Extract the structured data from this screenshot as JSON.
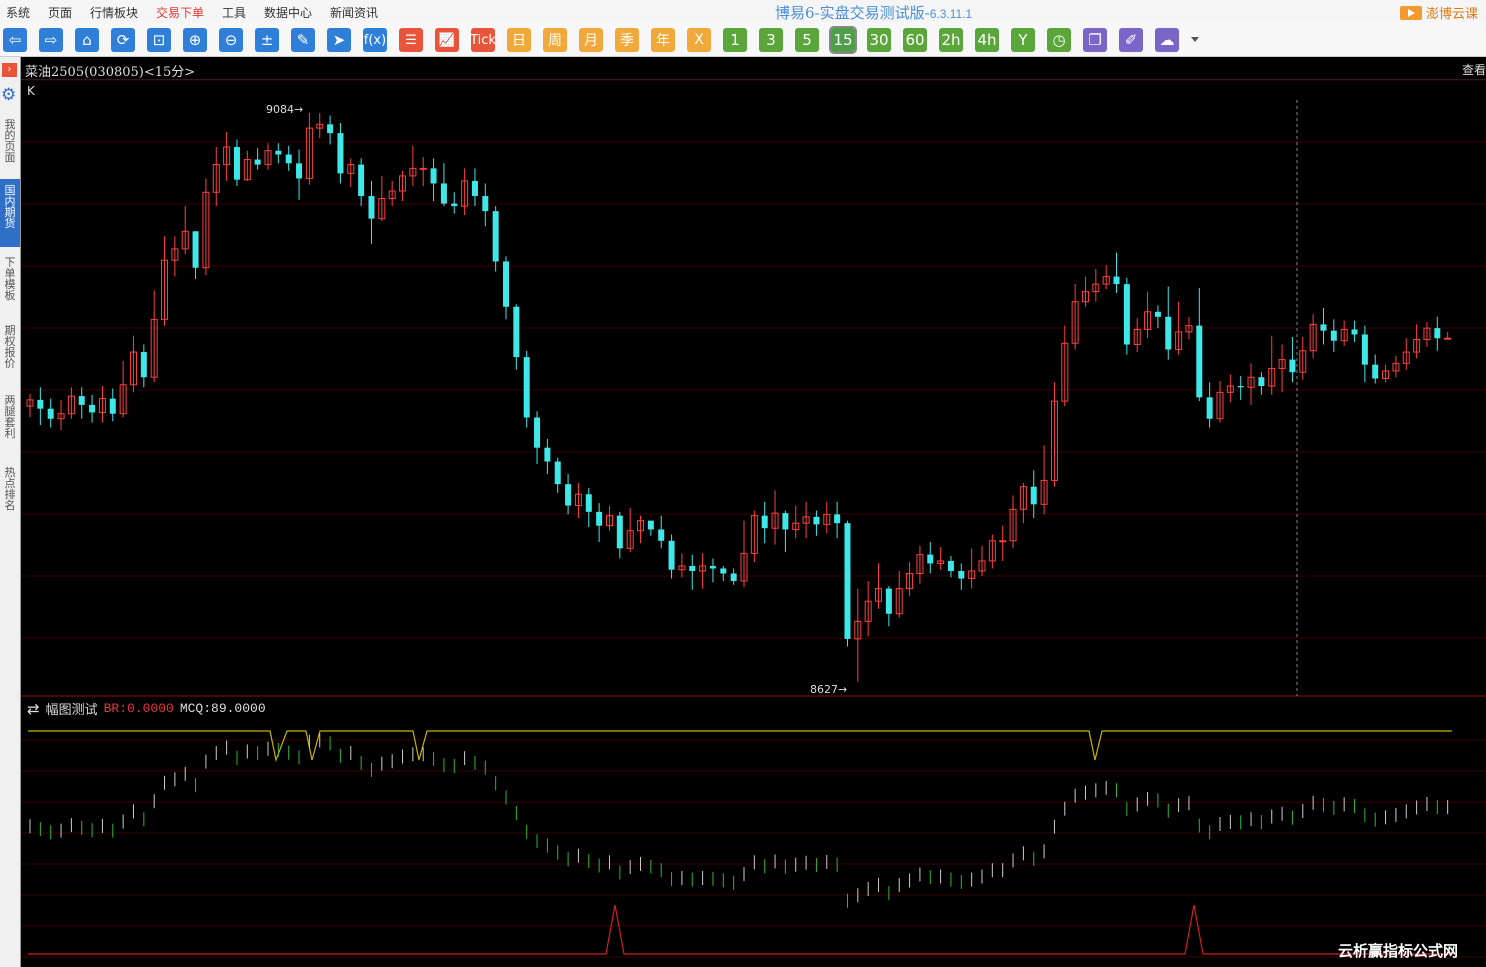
{
  "menu": [
    "系统",
    "页面",
    "行情板块",
    "交易下单",
    "工具",
    "数据中心",
    "新闻资讯"
  ],
  "menu_active_index": 3,
  "app": {
    "title": "博易6-实盘交易测试版-",
    "version": "6.3.11.1",
    "brand": "澎博云课"
  },
  "toolbar": {
    "buttons": [
      {
        "name": "back-arrow-icon",
        "glyph": "⇦",
        "color": "blue"
      },
      {
        "name": "forward-arrow-icon",
        "glyph": "⇨",
        "color": "blue"
      },
      {
        "name": "home-icon",
        "glyph": "⌂",
        "color": "blue"
      },
      {
        "name": "refresh-icon",
        "glyph": "⟳",
        "color": "blue"
      },
      {
        "name": "crop-icon",
        "glyph": "⊡",
        "color": "blue"
      },
      {
        "name": "zoom-in-icon",
        "glyph": "⊕",
        "color": "blue"
      },
      {
        "name": "zoom-out-icon",
        "glyph": "⊖",
        "color": "blue"
      },
      {
        "name": "calculator-icon",
        "glyph": "±",
        "color": "blue"
      },
      {
        "name": "pencil-icon",
        "glyph": "✎",
        "color": "blue"
      },
      {
        "name": "cursor-icon",
        "glyph": "➤",
        "color": "blue"
      },
      {
        "name": "formula-icon",
        "glyph": "f(x)",
        "color": "blue"
      },
      {
        "name": "list-icon",
        "glyph": "☰",
        "color": "red"
      },
      {
        "name": "chart-line-icon",
        "glyph": "📈",
        "color": "red"
      },
      {
        "name": "tick-button",
        "glyph": "Tick",
        "color": "red"
      },
      {
        "name": "period-day-button",
        "glyph": "日",
        "color": "orange"
      },
      {
        "name": "period-week-button",
        "glyph": "周",
        "color": "orange"
      },
      {
        "name": "period-month-button",
        "glyph": "月",
        "color": "orange"
      },
      {
        "name": "period-season-button",
        "glyph": "季",
        "color": "orange"
      },
      {
        "name": "period-year-button",
        "glyph": "年",
        "color": "orange"
      },
      {
        "name": "period-x-button",
        "glyph": "X",
        "color": "orange"
      },
      {
        "name": "period-1-button",
        "glyph": "1",
        "color": "green"
      },
      {
        "name": "period-3-button",
        "glyph": "3",
        "color": "green"
      },
      {
        "name": "period-5-button",
        "glyph": "5",
        "color": "green"
      },
      {
        "name": "period-15-button",
        "glyph": "15",
        "color": "green"
      },
      {
        "name": "period-30-button",
        "glyph": "30",
        "color": "green"
      },
      {
        "name": "period-60-button",
        "glyph": "60",
        "color": "green"
      },
      {
        "name": "period-2h-button",
        "glyph": "2h",
        "color": "green"
      },
      {
        "name": "period-4h-button",
        "glyph": "4h",
        "color": "green"
      },
      {
        "name": "period-y-button",
        "glyph": "Y",
        "color": "green"
      },
      {
        "name": "clock-icon",
        "glyph": "◷",
        "color": "green"
      },
      {
        "name": "window-icon",
        "glyph": "❐",
        "color": "purple"
      },
      {
        "name": "draw-icon",
        "glyph": "✐",
        "color": "purple"
      },
      {
        "name": "cloud-icon",
        "glyph": "☁",
        "color": "purple"
      }
    ],
    "selected": "15"
  },
  "sidebar": {
    "toggle": "›",
    "items": [
      "我的页面",
      "国内期货",
      "下单模板",
      "期权报价",
      "两腿套利",
      "热点排名"
    ],
    "active_index": 1
  },
  "header": {
    "contract": "菜油2505(030805)<15分>",
    "view": "查看"
  },
  "main": {
    "label": "K",
    "high_label": "9084",
    "low_label": "8627"
  },
  "indicator": {
    "name": "幅图测试",
    "br": "BR:0.0000",
    "mcq": "MCQ:89.0000"
  },
  "watermark": "云析赢指标公式网",
  "colors": {
    "up": "#ff4040",
    "down": "#3ee8e8",
    "bg": "#000000",
    "grid": "#3a0000",
    "yellow": "#c8b400",
    "green": "#2fb82f",
    "white": "#cccccc",
    "red": "#d02020"
  },
  "chart_data": {
    "type": "candlestick",
    "high": 9084,
    "low": 8627,
    "candles": [
      [
        8851,
        8856,
        8842,
        8861
      ],
      [
        8856,
        8849,
        8836,
        8866
      ],
      [
        8849,
        8841,
        8834,
        8857
      ],
      [
        8841,
        8845,
        8832,
        8856
      ],
      [
        8845,
        8859,
        8841,
        8866
      ],
      [
        8859,
        8852,
        8841,
        8866
      ],
      [
        8852,
        8846,
        8838,
        8860
      ],
      [
        8846,
        8857,
        8838,
        8867
      ],
      [
        8857,
        8845,
        8839,
        8865
      ],
      [
        8845,
        8868,
        8842,
        8887
      ],
      [
        8868,
        8894,
        8862,
        8907
      ],
      [
        8894,
        8874,
        8866,
        8900
      ],
      [
        8874,
        8920,
        8870,
        8943
      ],
      [
        8920,
        8967,
        8915,
        8986
      ],
      [
        8967,
        8976,
        8954,
        8986
      ],
      [
        8976,
        8990,
        8972,
        9010
      ],
      [
        8990,
        8961,
        8952,
        8990
      ],
      [
        8961,
        9021,
        8955,
        9032
      ],
      [
        9021,
        9043,
        9010,
        9057
      ],
      [
        9043,
        9057,
        9030,
        9069
      ],
      [
        9057,
        9031,
        9026,
        9063
      ],
      [
        9031,
        9047,
        9030,
        9054
      ],
      [
        9047,
        9043,
        9039,
        9056
      ],
      [
        9043,
        9054,
        9039,
        9060
      ],
      [
        9054,
        9051,
        9044,
        9060
      ],
      [
        9051,
        9044,
        9038,
        9058
      ],
      [
        9044,
        9032,
        9015,
        9055
      ],
      [
        9032,
        9072,
        9027,
        9084
      ],
      [
        9072,
        9075,
        9064,
        9084
      ],
      [
        9075,
        9068,
        9059,
        9082
      ],
      [
        9068,
        9036,
        9028,
        9076
      ],
      [
        9036,
        9043,
        9025,
        9048
      ],
      [
        9043,
        9018,
        9010,
        9048
      ],
      [
        9018,
        9000,
        8980,
        9030
      ],
      [
        9000,
        9016,
        8998,
        9034
      ],
      [
        9016,
        9022,
        9010,
        9030
      ],
      [
        9022,
        9034,
        9014,
        9038
      ],
      [
        9034,
        9040,
        9026,
        9058
      ],
      [
        9040,
        9040,
        9026,
        9049
      ],
      [
        9040,
        9028,
        9014,
        9048
      ],
      [
        9028,
        9012,
        9010,
        9044
      ],
      [
        9012,
        9010,
        9004,
        9021
      ],
      [
        9010,
        9030,
        9003,
        9040
      ],
      [
        9030,
        9018,
        9010,
        9040
      ],
      [
        9018,
        9006,
        8994,
        9028
      ],
      [
        9006,
        8966,
        8958,
        9010
      ],
      [
        8966,
        8930,
        8920,
        8970
      ],
      [
        8930,
        8890,
        8880,
        8932
      ],
      [
        8890,
        8842,
        8834,
        8895
      ],
      [
        8842,
        8818,
        8805,
        8847
      ],
      [
        8818,
        8807,
        8797,
        8825
      ],
      [
        8807,
        8789,
        8782,
        8810
      ],
      [
        8789,
        8772,
        8765,
        8797
      ],
      [
        8772,
        8781,
        8762,
        8790
      ],
      [
        8781,
        8767,
        8755,
        8786
      ],
      [
        8767,
        8756,
        8743,
        8774
      ],
      [
        8756,
        8764,
        8752,
        8772
      ],
      [
        8764,
        8738,
        8730,
        8767
      ],
      [
        8738,
        8752,
        8735,
        8770
      ],
      [
        8752,
        8760,
        8742,
        8764
      ],
      [
        8760,
        8753,
        8748,
        8760
      ],
      [
        8753,
        8744,
        8738,
        8764
      ],
      [
        8744,
        8721,
        8714,
        8749
      ],
      [
        8721,
        8724,
        8715,
        8734
      ],
      [
        8724,
        8720,
        8705,
        8733
      ],
      [
        8720,
        8724,
        8706,
        8734
      ],
      [
        8724,
        8722,
        8711,
        8730
      ],
      [
        8722,
        8718,
        8712,
        8724
      ],
      [
        8718,
        8712,
        8709,
        8722
      ],
      [
        8712,
        8734,
        8707,
        8760
      ],
      [
        8734,
        8764,
        8727,
        8768
      ],
      [
        8764,
        8754,
        8742,
        8775
      ],
      [
        8754,
        8766,
        8741,
        8784
      ],
      [
        8766,
        8753,
        8735,
        8768
      ],
      [
        8753,
        8758,
        8746,
        8772
      ],
      [
        8758,
        8763,
        8746,
        8775
      ],
      [
        8763,
        8757,
        8748,
        8768
      ],
      [
        8757,
        8765,
        8750,
        8775
      ],
      [
        8765,
        8758,
        8746,
        8775
      ],
      [
        8758,
        8666,
        8660,
        8760
      ],
      [
        8666,
        8680,
        8632,
        8706
      ],
      [
        8680,
        8696,
        8668,
        8712
      ],
      [
        8696,
        8706,
        8690,
        8726
      ],
      [
        8706,
        8686,
        8676,
        8708
      ],
      [
        8686,
        8706,
        8683,
        8720
      ],
      [
        8706,
        8718,
        8700,
        8727
      ],
      [
        8718,
        8733,
        8710,
        8740
      ],
      [
        8733,
        8726,
        8718,
        8743
      ],
      [
        8726,
        8728,
        8721,
        8739
      ],
      [
        8728,
        8720,
        8715,
        8732
      ],
      [
        8720,
        8714,
        8705,
        8726
      ],
      [
        8714,
        8720,
        8706,
        8738
      ],
      [
        8720,
        8728,
        8716,
        8740
      ],
      [
        8728,
        8744,
        8722,
        8749
      ],
      [
        8744,
        8744,
        8728,
        8756
      ],
      [
        8744,
        8769,
        8738,
        8780
      ],
      [
        8769,
        8787,
        8758,
        8790
      ],
      [
        8787,
        8773,
        8762,
        8800
      ],
      [
        8773,
        8792,
        8765,
        8820
      ],
      [
        8792,
        8855,
        8787,
        8870
      ],
      [
        8855,
        8901,
        8851,
        8915
      ],
      [
        8901,
        8934,
        8896,
        8948
      ],
      [
        8934,
        8942,
        8930,
        8954
      ],
      [
        8942,
        8948,
        8934,
        8960
      ],
      [
        8948,
        8954,
        8944,
        8963
      ],
      [
        8954,
        8948,
        8941,
        8973
      ],
      [
        8948,
        8900,
        8892,
        8953
      ],
      [
        8900,
        8912,
        8894,
        8921
      ],
      [
        8912,
        8926,
        8905,
        8942
      ],
      [
        8926,
        8922,
        8913,
        8931
      ],
      [
        8922,
        8896,
        8888,
        8946
      ],
      [
        8896,
        8910,
        8892,
        8934
      ],
      [
        8910,
        8915,
        8904,
        8922
      ],
      [
        8915,
        8858,
        8855,
        8945
      ],
      [
        8858,
        8841,
        8834,
        8870
      ],
      [
        8841,
        8862,
        8838,
        8871
      ],
      [
        8862,
        8867,
        8854,
        8876
      ],
      [
        8867,
        8866,
        8856,
        8875
      ],
      [
        8866,
        8874,
        8852,
        8885
      ],
      [
        8874,
        8867,
        8860,
        8878
      ],
      [
        8867,
        8881,
        8860,
        8907
      ],
      [
        8881,
        8888,
        8862,
        8900
      ],
      [
        8888,
        8878,
        8870,
        8906
      ],
      [
        8878,
        8895,
        8872,
        8906
      ],
      [
        8895,
        8916,
        8889,
        8924
      ],
      [
        8916,
        8911,
        8900,
        8929
      ],
      [
        8911,
        8903,
        8894,
        8920
      ],
      [
        8903,
        8912,
        8899,
        8919
      ],
      [
        8912,
        8908,
        8902,
        8919
      ],
      [
        8908,
        8884,
        8870,
        8915
      ],
      [
        8884,
        8873,
        8869,
        8892
      ],
      [
        8873,
        8879,
        8870,
        8884
      ],
      [
        8879,
        8885,
        8874,
        8891
      ],
      [
        8885,
        8894,
        8880,
        8905
      ],
      [
        8894,
        8904,
        8889,
        8916
      ],
      [
        8904,
        8913,
        8898,
        8918
      ],
      [
        8913,
        8905,
        8895,
        8922
      ],
      [
        8905,
        8905,
        8904,
        8910
      ]
    ]
  }
}
